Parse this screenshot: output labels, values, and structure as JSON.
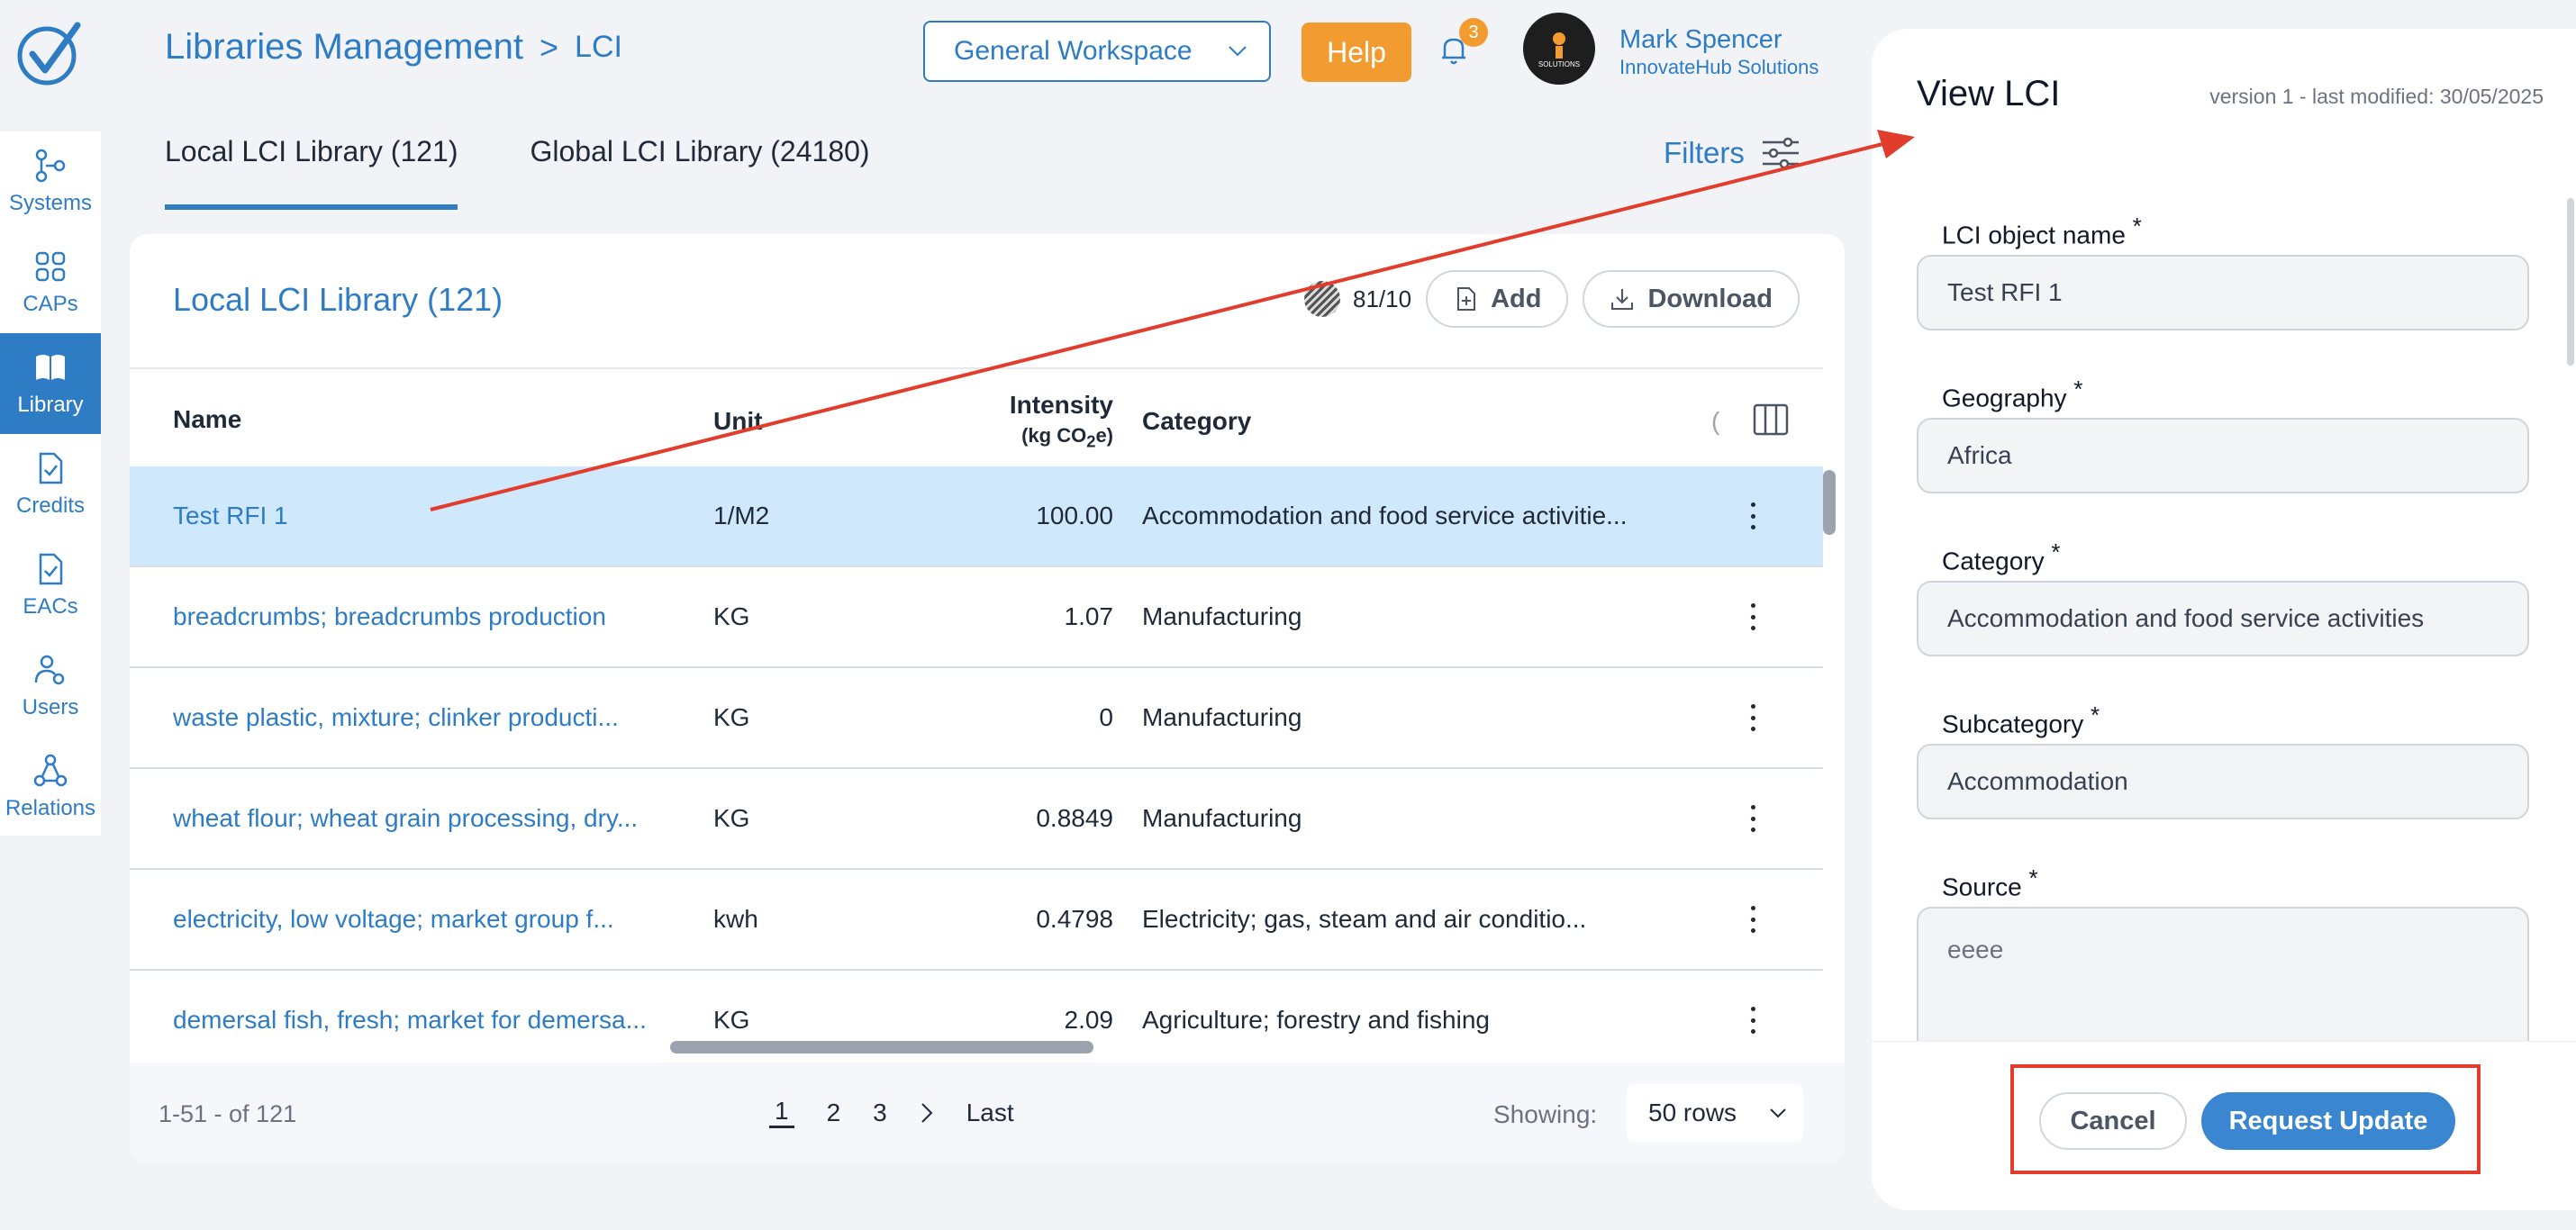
{
  "header": {
    "breadcrumb_root": "Libraries Management",
    "breadcrumb_sep": ">",
    "breadcrumb_leaf": "LCI",
    "workspace": "General Workspace",
    "help_label": "Help",
    "notification_count": "3",
    "avatar_text": "SOLUTIONS",
    "user_name": "Mark Spencer",
    "user_org": "InnovateHub Solutions"
  },
  "sidebar": {
    "items": [
      {
        "label": "Systems",
        "icon": "systems-icon"
      },
      {
        "label": "CAPs",
        "icon": "grid-icon"
      },
      {
        "label": "Library",
        "icon": "book-icon"
      },
      {
        "label": "Credits",
        "icon": "document-check-icon"
      },
      {
        "label": "EACs",
        "icon": "document-check-icon"
      },
      {
        "label": "Users",
        "icon": "users-gear-icon"
      },
      {
        "label": "Relations",
        "icon": "relations-icon"
      }
    ],
    "active": "Library"
  },
  "tabs": [
    {
      "label": "Local LCI Library (121)",
      "active": true
    },
    {
      "label": "Global LCI Library (24180)",
      "active": false
    }
  ],
  "filters_label": "Filters",
  "card": {
    "title": "Local LCI Library (121)",
    "counter_used": "81",
    "counter_sep": "/",
    "counter_total": "10",
    "add_label": "Add",
    "download_label": "Download"
  },
  "table": {
    "headers": {
      "name": "Name",
      "unit": "Unit",
      "intensity": "Intensity",
      "intensity_unit_pre": "(kg CO",
      "intensity_unit_sub": "2",
      "intensity_unit_post": "e)",
      "category": "Category",
      "extra": "("
    },
    "rows": [
      {
        "name": "Test RFI 1",
        "unit": "1/M2",
        "intensity": "100.00",
        "category": "Accommodation and food service activitie...",
        "selected": true
      },
      {
        "name": "breadcrumbs; breadcrumbs production",
        "unit": "KG",
        "intensity": "1.07",
        "category": "Manufacturing",
        "selected": false
      },
      {
        "name": "waste plastic, mixture; clinker producti...",
        "unit": "KG",
        "intensity": "0",
        "category": "Manufacturing",
        "selected": false
      },
      {
        "name": "wheat flour; wheat grain processing, dry...",
        "unit": "KG",
        "intensity": "0.8849",
        "category": "Manufacturing",
        "selected": false
      },
      {
        "name": "electricity, low voltage; market group f...",
        "unit": "kwh",
        "intensity": "0.4798",
        "category": "Electricity; gas, steam and air conditio...",
        "selected": false
      },
      {
        "name": "demersal fish, fresh; market for demersa...",
        "unit": "KG",
        "intensity": "2.09",
        "category": "Agriculture; forestry and fishing",
        "selected": false
      }
    ]
  },
  "footer": {
    "range": "1-51 - of 121",
    "pages": [
      "1",
      "2",
      "3"
    ],
    "current_page": "1",
    "last_label": "Last",
    "showing_label": "Showing:",
    "rows_value": "50 rows"
  },
  "panel": {
    "title": "View LCI",
    "version": "version 1 - last modified: 30/05/2025",
    "required_mark": "*",
    "fields": [
      {
        "label": "LCI object name",
        "value": "Test RFI 1"
      },
      {
        "label": "Geography",
        "value": "Africa"
      },
      {
        "label": "Category",
        "value": "Accommodation and food service activities"
      },
      {
        "label": "Subcategory",
        "value": "Accommodation"
      },
      {
        "label": "Source",
        "value": "eeee"
      }
    ],
    "cancel_label": "Cancel",
    "request_label": "Request Update"
  },
  "colors": {
    "accent": "#2e7cc4",
    "help": "#f29b30",
    "selected_row": "#cfe8fb",
    "annotation": "#e23c2d",
    "primary_button": "#3a86d1"
  }
}
